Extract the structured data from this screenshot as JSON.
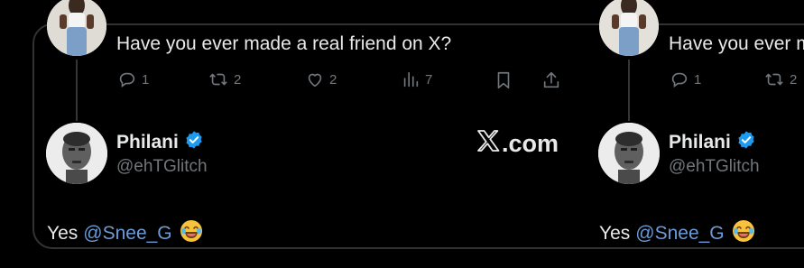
{
  "original_tweet": {
    "text": "Have you ever made a real friend on X?",
    "replies": "1",
    "reposts": "2",
    "likes": "2",
    "views": "7"
  },
  "reply_tweet": {
    "name": "Philani",
    "handle": "@ehTGlitch",
    "text_prefix": "Yes",
    "mention": "@Snee_G"
  },
  "right_preview": {
    "text": "Have you ever m",
    "replies": "1",
    "reposts": "2",
    "name": "Philani",
    "handle": "@ehTGlitch",
    "text_prefix": "Yes",
    "mention": "@Snee_G"
  },
  "watermark": {
    "x_glyph": "𝕏",
    "domain": ".com"
  },
  "colors": {
    "background": "#000000",
    "text": "#e7e9ea",
    "muted": "#71767b",
    "mention": "#6b9bd8",
    "verified": "#1d9bf0",
    "border": "#2f3336"
  },
  "icons": [
    "reply-icon",
    "repost-icon",
    "like-icon",
    "views-icon",
    "bookmark-icon",
    "share-icon",
    "verified-badge-icon",
    "laughing-emoji-icon"
  ]
}
